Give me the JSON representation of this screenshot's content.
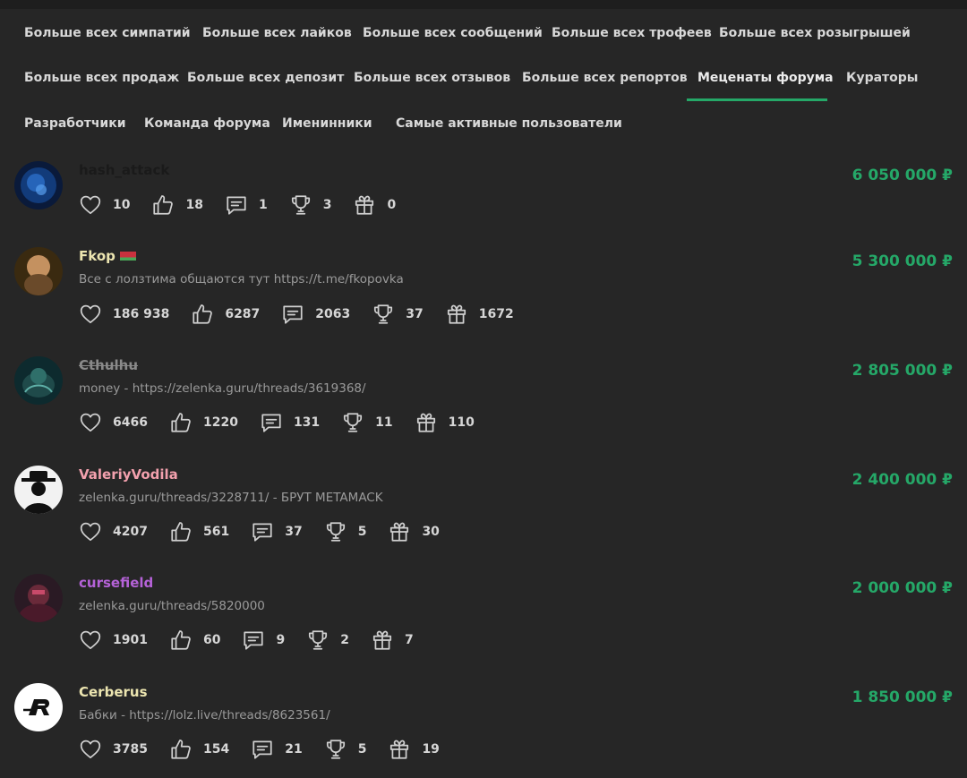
{
  "tabs": [
    "Больше всех симпатий",
    "Больше всех лайков",
    "Больше всех сообщений",
    "Больше всех трофеев",
    "Больше всех розыгрышей",
    "Больше всех продаж",
    "Больше всех депозит",
    "Больше всех отзывов",
    "Больше всех репортов",
    "Меценаты форума",
    "Кураторы",
    "Разработчики",
    "Команда форума",
    "Именинники",
    "Самые активные пользователи"
  ],
  "active_tab": "Меценаты форума",
  "colors": {
    "accent": "#25a868",
    "background": "#262626"
  },
  "users": [
    {
      "name": "hash_attack",
      "name_color": "#1a1a1a",
      "status": "",
      "amount": "6 050 000 ₽",
      "stats": {
        "likes": "10",
        "thumbs": "18",
        "messages": "1",
        "trophies": "3",
        "gifts": "0"
      }
    },
    {
      "name": "Fkop",
      "name_color": "#ece5b0",
      "status": "Все с лолзтима общаются тут https://t.me/fkopovka",
      "amount": "5 300 000 ₽",
      "stats": {
        "likes": "186 938",
        "thumbs": "6287",
        "messages": "2063",
        "trophies": "37",
        "gifts": "1672"
      }
    },
    {
      "name": "Cthulhu",
      "name_color": "#8a8a8a",
      "status": "money - https://zelenka.guru/threads/3619368/",
      "amount": "2 805 000 ₽",
      "stats": {
        "likes": "6466",
        "thumbs": "1220",
        "messages": "131",
        "trophies": "11",
        "gifts": "110"
      }
    },
    {
      "name": "ValeriyVodila",
      "name_color": "#f2a0ad",
      "status": "zelenka.guru/threads/3228711/ - БРУТ METAMACK",
      "amount": "2 400 000 ₽",
      "stats": {
        "likes": "4207",
        "thumbs": "561",
        "messages": "37",
        "trophies": "5",
        "gifts": "30"
      }
    },
    {
      "name": "cursefield",
      "name_color": "#b562d8",
      "status": "zelenka.guru/threads/5820000",
      "amount": "2 000 000 ₽",
      "stats": {
        "likes": "1901",
        "thumbs": "60",
        "messages": "9",
        "trophies": "2",
        "gifts": "7"
      }
    },
    {
      "name": "Cerberus",
      "name_color": "#ece5b0",
      "status": "Бабки - https://lolz.live/threads/8623561/",
      "amount": "1 850 000 ₽",
      "stats": {
        "likes": "3785",
        "thumbs": "154",
        "messages": "21",
        "trophies": "5",
        "gifts": "19"
      }
    }
  ]
}
